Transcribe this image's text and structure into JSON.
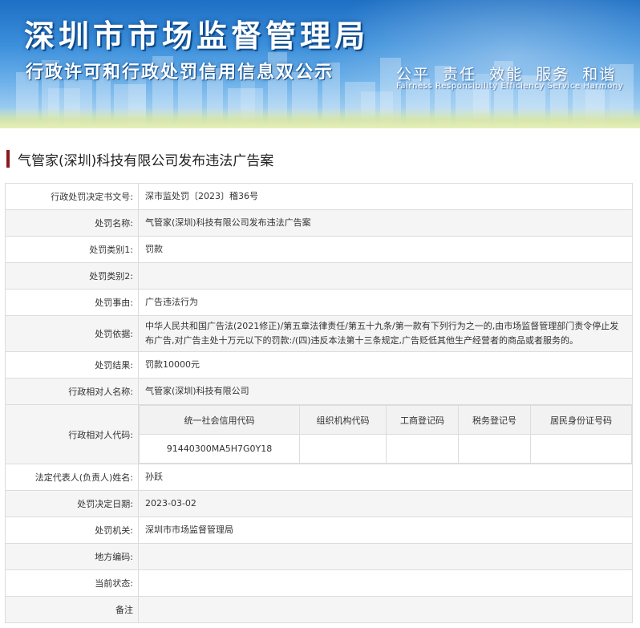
{
  "banner": {
    "title_main": "深圳市市场监督管理局",
    "title_sub": "行政许可和行政处罚信用信息双公示",
    "motto": "公平  责任  效能  服务  和谐",
    "motto_en": "Fairness  Responsibility  Efficiency  Service  Harmony"
  },
  "case": {
    "title": "气管家(深圳)科技有限公司发布违法广告案"
  },
  "rows": {
    "doc_no": {
      "label": "行政处罚决定书文号:",
      "value": "深市监处罚〔2023〕稽36号"
    },
    "name": {
      "label": "处罚名称:",
      "value": "气管家(深圳)科技有限公司发布违法广告案"
    },
    "type1": {
      "label": "处罚类别1:",
      "value": "罚款"
    },
    "type2": {
      "label": "处罚类别2:",
      "value": ""
    },
    "reason": {
      "label": "处罚事由:",
      "value": "广告违法行为"
    },
    "basis": {
      "label": "处罚依据:",
      "value": "中华人民共和国广告法(2021修正)/第五章法律责任/第五十九条/第一款有下列行为之一的,由市场监督管理部门责令停止发布广告,对广告主处十万元以下的罚款:/(四)违反本法第十三条规定,广告贬低其他生产经营者的商品或者服务的。"
    },
    "result": {
      "label": "处罚结果:",
      "value": "罚款10000元"
    },
    "party_name": {
      "label": "行政相对人名称:",
      "value": "气管家(深圳)科技有限公司"
    },
    "party_code": {
      "label": "行政相对人代码:",
      "headers": [
        "统一社会信用代码",
        "组织机构代码",
        "工商登记码",
        "税务登记号",
        "居民身份证号码"
      ],
      "values": [
        "91440300MA5H7G0Y18",
        "",
        "",
        "",
        ""
      ]
    },
    "legal_rep": {
      "label": "法定代表人(负责人)姓名:",
      "value": "孙跃"
    },
    "decision_date": {
      "label": "处罚决定日期:",
      "value": "2023-03-02"
    },
    "authority": {
      "label": "处罚机关:",
      "value": "深圳市市场监督管理局"
    },
    "region_code": {
      "label": "地方编码:",
      "value": ""
    },
    "status": {
      "label": "当前状态:",
      "value": ""
    },
    "remark": {
      "label": "备注",
      "value": ""
    }
  },
  "colors": {
    "accent_bar": "#8b1a1a",
    "banner_blue": "#1d6fc4",
    "row_alt": "#f5f5f5",
    "border": "#dcdcdc"
  }
}
